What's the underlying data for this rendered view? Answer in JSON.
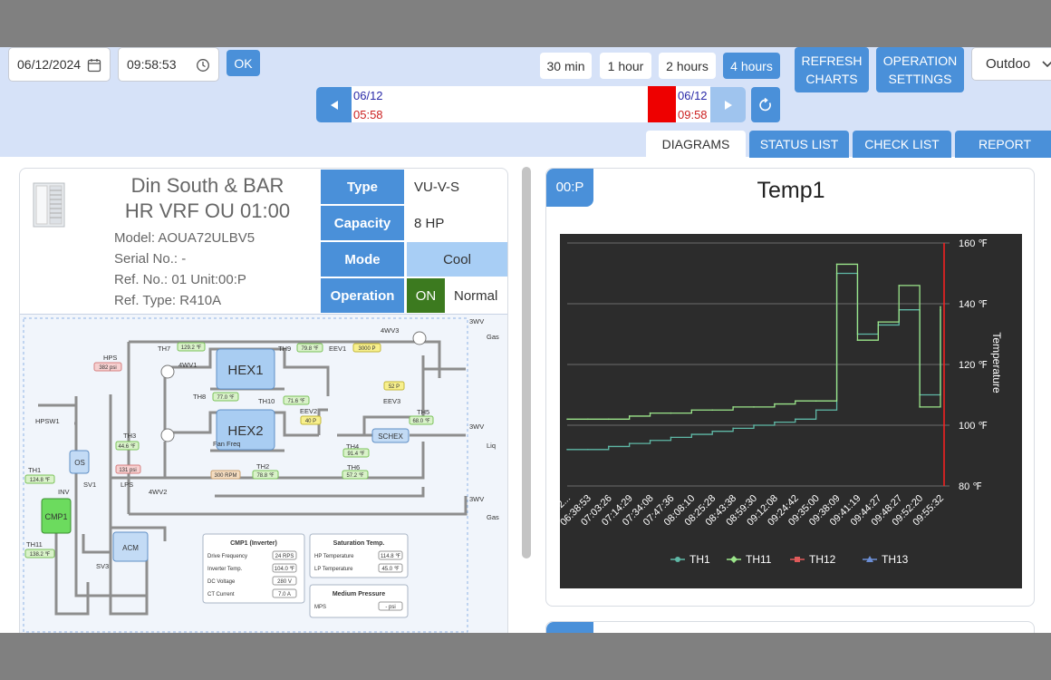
{
  "toolbar": {
    "date_value": "06/12/2024",
    "time_value": "09:58:53",
    "ok_label": "OK",
    "range_buttons": [
      "30 min",
      "1 hour",
      "2 hours",
      "4 hours"
    ],
    "active_range": "4 hours",
    "refresh_label": [
      "REFRESH",
      "CHARTS"
    ],
    "operation_label": [
      "OPERATION",
      "SETTINGS"
    ],
    "select_value": "Outdoo"
  },
  "timeline": {
    "start_date": "06/12",
    "start_time": "05:58",
    "end_date": "06/12",
    "end_time": "09:58"
  },
  "tabs": [
    "DIAGRAMS",
    "STATUS LIST",
    "CHECK LIST",
    "REPORT"
  ],
  "active_tab": "DIAGRAMS",
  "unit": {
    "title_line1": "Din South & BAR",
    "title_line2": "HR VRF OU 01:00",
    "model": "Model: AOUA72ULBV5",
    "serial": "Serial No.: -",
    "ref_no": "Ref. No.: 01 Unit:00:P",
    "ref_type": "Ref. Type: R410A",
    "props": [
      {
        "label": "Type",
        "value": "VU-V-S"
      },
      {
        "label": "Capacity",
        "value": "8 HP"
      },
      {
        "label": "Mode",
        "value": "Cool"
      },
      {
        "label": "Operation",
        "value_on": "ON",
        "value": "Normal"
      }
    ]
  },
  "diagram": {
    "labels": {
      "wv3_top": "3WV",
      "gas1": "Gas",
      "wv4_3": "4WV3",
      "th7": "TH7",
      "th7_val": "129.2 ℉",
      "th9": "TH9",
      "th9_val": "79.8 ℉",
      "eev1": "EEV1",
      "eev1_val": "3000 P",
      "hps": "HPS",
      "hps_val": "382 psi",
      "wv4_1": "4WV1",
      "hex1": "HEX1",
      "eev3": "EEV3",
      "eev3_val": "52 P",
      "th8": "TH8",
      "th8_val": "77.0 ℉",
      "th10": "TH10",
      "th10_val": "71.6 ℉",
      "th5": "TH5",
      "th5_val": "68.0 ℉",
      "eev2": "EEV2",
      "eev2_val": "40 P",
      "hpsw1": "HPSW1",
      "hex2": "HEX2",
      "wv3_mid": "3WV",
      "liq": "Liq",
      "th3": "TH3",
      "th3_val": "44.6 ℉",
      "schex": "SCHEX",
      "th4": "TH4",
      "th4_val": "91.4 ℉",
      "os": "OS",
      "lps_val": "131 psi",
      "fan_freq": "Fan Freq",
      "fan_val": "300 RPM",
      "th2": "TH2",
      "th2_val": "78.8 ℉",
      "th6": "TH6",
      "th6_val": "57.2 ℉",
      "th1": "TH1",
      "th1_val": "124.8 ℉",
      "sv1": "SV1",
      "inv": "INV",
      "lps": "LPS",
      "wv4_2": "4WV2",
      "wv3_bot": "3WV",
      "gas2": "Gas",
      "cmp1": "CMP1",
      "th11": "TH11",
      "th11_val": "138.2 ℉",
      "acm": "ACM",
      "sv3": "SV3"
    },
    "cmp_box": {
      "title": "CMP1 (Inverter)",
      "rows": [
        {
          "label": "Drive Frequency",
          "value": "24 RPS"
        },
        {
          "label": "Inverter Temp.",
          "value": "104.0 ℉"
        },
        {
          "label": "DC Voltage",
          "value": "280 V"
        },
        {
          "label": "CT Current",
          "value": "7.0 A"
        }
      ]
    },
    "sat_box": {
      "title": "Saturation Temp.",
      "rows": [
        {
          "label": "HP Temperature",
          "value": "114.8 ℉"
        },
        {
          "label": "LP Temperature",
          "value": "45.0 ℉"
        }
      ]
    },
    "mp_box": {
      "title": "Medium Pressure",
      "rows": [
        {
          "label": "MPS",
          "value": "- psi"
        }
      ]
    }
  },
  "chart_panel": {
    "badge": "00:P",
    "title": "Temp1"
  },
  "chart_data": {
    "type": "line",
    "title": "Temp1",
    "ylabel": "Temperature",
    "xlabel": "",
    "ylim": [
      80,
      160
    ],
    "yticks": [
      "160 ℉",
      "140 ℉",
      "120 ℉",
      "100 ℉",
      "80 ℉"
    ],
    "ytick_values": [
      160,
      140,
      120,
      100,
      80
    ],
    "x": [
      "06:2...",
      "06:38:53",
      "07:03:26",
      "07:14:29",
      "07:34:08",
      "07:47:36",
      "08:08:10",
      "08:25:28",
      "08:43:38",
      "08:59:30",
      "09:12:08",
      "09:24:42",
      "09:35:00",
      "09:38:09",
      "09:41:19",
      "09:44:27",
      "09:48:27",
      "09:52:20",
      "09:55:32"
    ],
    "series": [
      {
        "name": "TH1",
        "color": "#5fb8a6",
        "values": [
          92,
          92,
          93,
          94,
          95,
          96,
          97,
          98,
          99,
          100,
          101,
          102,
          105,
          150,
          130,
          133,
          138,
          110,
          138
        ]
      },
      {
        "name": "TH11",
        "color": "#9be58a",
        "values": [
          102,
          102,
          102,
          103,
          104,
          104,
          105,
          105,
          106,
          106,
          107,
          108,
          108,
          153,
          128,
          134,
          146,
          106,
          139
        ]
      },
      {
        "name": "TH12",
        "color": "#e05a5a",
        "values": []
      },
      {
        "name": "TH13",
        "color": "#6c8fd6",
        "values": []
      }
    ],
    "legend": "bottom",
    "marker_line_color": "#ff2020",
    "grid": true
  },
  "colors": {
    "accent": "#4a90d9",
    "topbar_bg": "#d6e2f8",
    "mode_bg": "#a8cef5",
    "on_bg": "#3c7a1f",
    "danger": "#ee0000"
  }
}
